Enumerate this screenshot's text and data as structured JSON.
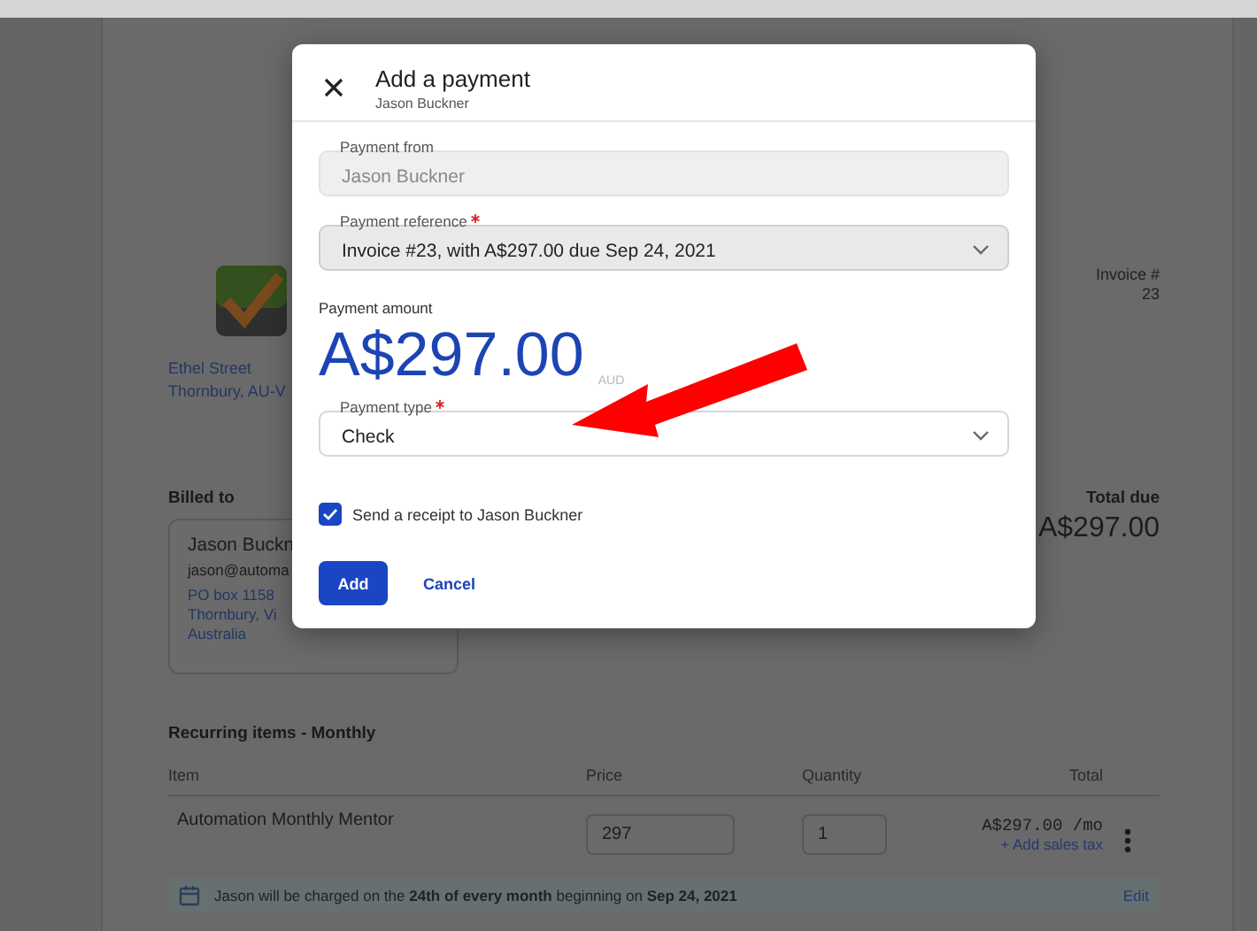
{
  "invoice": {
    "address": [
      "Ethel Street",
      "Thornbury, AU-V"
    ],
    "invoice_label": "Invoice #",
    "invoice_number": "23",
    "billed_to": {
      "heading": "Billed to",
      "name": "Jason Buckn",
      "email": "jason@automa",
      "address": [
        "PO box 1158",
        "Thornbury, Vi",
        "Australia"
      ]
    },
    "total_due": {
      "label": "Total due",
      "value": "A$297.00"
    },
    "recurring": {
      "heading": "Recurring items - Monthly",
      "columns": [
        "Item",
        "Price",
        "Quantity",
        "Total"
      ],
      "rows": [
        {
          "item": "Automation Monthly Mentor",
          "price": "297",
          "quantity": "1",
          "total": "A$297.00 /mo",
          "tax_link": "+ Add sales tax"
        }
      ]
    },
    "schedule": {
      "text": "Jason will be charged on the **24th of every month** beginning on **Sep 24, 2021**",
      "action": "Edit"
    }
  },
  "dialog": {
    "title": "Add a payment",
    "subtitle": "Jason Buckner",
    "fields": [
      {
        "kind": "text",
        "label": "Payment from",
        "value": "Jason Buckner",
        "disabled": true,
        "required": false
      },
      {
        "kind": "select",
        "label": "Payment reference",
        "value": "Invoice #23, with A$297.00 due Sep 24, 2021",
        "disabled": false,
        "required": true
      }
    ],
    "amount": {
      "label": "Payment amount",
      "value": "A$297.00",
      "currency": "AUD"
    },
    "payment_type": {
      "kind": "select",
      "label": "Payment type",
      "value": "Check",
      "required": true,
      "focused": true
    },
    "receipt": {
      "label": "Send a receipt to Jason Buckner",
      "checked": true
    },
    "buttons": [
      {
        "kind": "primary",
        "label": "Add"
      },
      {
        "kind": "text",
        "label": "Cancel"
      }
    ]
  }
}
